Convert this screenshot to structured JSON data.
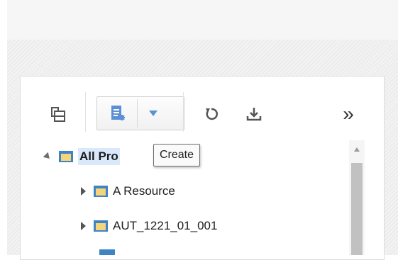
{
  "toolbar": {
    "icons": [
      "detach-icon",
      "create-icon",
      "dropdown-arrow-icon",
      "refresh-icon",
      "download-icon",
      "overflow-icon"
    ],
    "overflow_label": "»"
  },
  "tooltip": {
    "text": "Create"
  },
  "tree": {
    "nodes": [
      {
        "label": "All Pro",
        "expanded": true,
        "level": 0
      },
      {
        "label": "A Resource",
        "expanded": false,
        "level": 1
      },
      {
        "label": "AUT_1221_01_001",
        "expanded": false,
        "level": 1
      }
    ]
  },
  "colors": {
    "accent_blue": "#5b8fd6",
    "folder_blue": "#3d83c6",
    "folder_yellow": "#f6d57a",
    "selected_bg": "#d9e8fb"
  }
}
